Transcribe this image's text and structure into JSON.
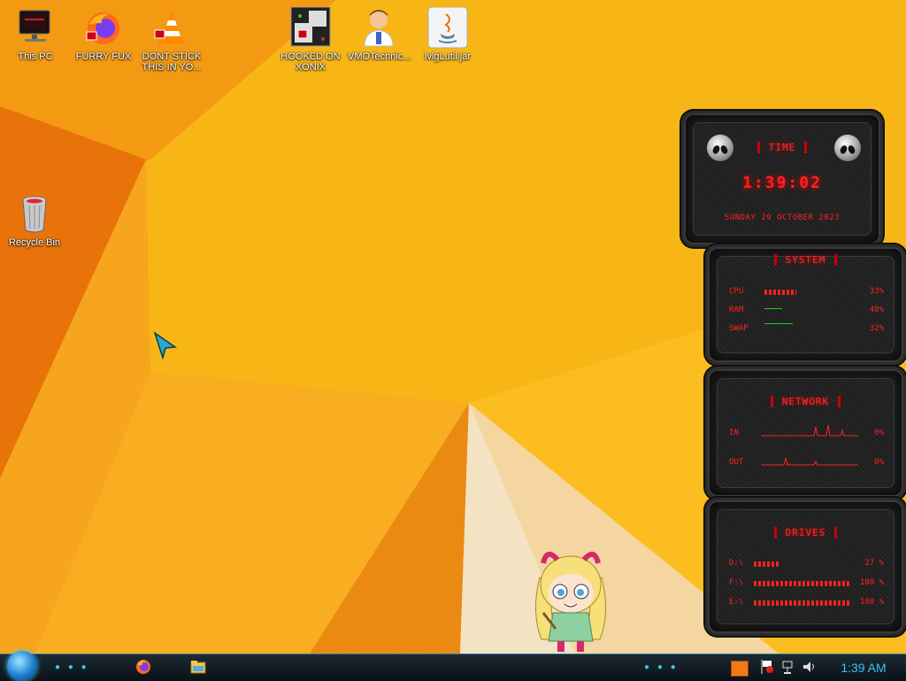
{
  "desktop": {
    "icons": [
      {
        "label": "This PC",
        "icon": "monitor-icon"
      },
      {
        "label": "FURRY FUX",
        "icon": "firefox-icon"
      },
      {
        "label": "DONT STICK THIS IN YO...",
        "icon": "vlc-cone-icon"
      },
      {
        "label": "HOOKED ON XONIX",
        "icon": "game-icon"
      },
      {
        "label": "VMOTechnic...",
        "icon": "doctor-person-icon"
      },
      {
        "label": "lvlgLutil.jar",
        "icon": "java-icon"
      },
      {
        "label": "Recycle Bin",
        "icon": "recycle-bin-icon"
      }
    ]
  },
  "widgets": {
    "time": {
      "title": "TIME",
      "clock": "1:39:02",
      "date": "SUNDAY 29 OCTOBER 2023"
    },
    "system": {
      "title": "SYSTEM",
      "rows": [
        {
          "label": "CPU",
          "value": "33%",
          "level": 0.33
        },
        {
          "label": "RAM",
          "value": "48%",
          "level": 0
        },
        {
          "label": "SWAP",
          "value": "32%",
          "level": 0
        }
      ]
    },
    "network": {
      "title": "NETWORK",
      "rows": [
        {
          "label": "IN",
          "value": "0%"
        },
        {
          "label": "OUT",
          "value": "0%"
        }
      ]
    },
    "drives": {
      "title": "DRIVES",
      "rows": [
        {
          "label": "D:\\",
          "value": "27 %",
          "level": 0.27
        },
        {
          "label": "F:\\",
          "value": "100 %",
          "level": 1.0
        },
        {
          "label": "E:\\",
          "value": "100 %",
          "level": 1.0
        }
      ]
    }
  },
  "taskbar": {
    "clock": "1:39 AM",
    "pinned": [
      "firefox-icon",
      "file-explorer-icon"
    ],
    "tray": [
      "app-tray-icon",
      "flag-icon",
      "network-icon",
      "volume-icon"
    ]
  },
  "colors": {
    "accent_red": "#e8101a",
    "taskbar_cyan": "#34c7f0",
    "wallpaper_orange": "#f6b212"
  }
}
